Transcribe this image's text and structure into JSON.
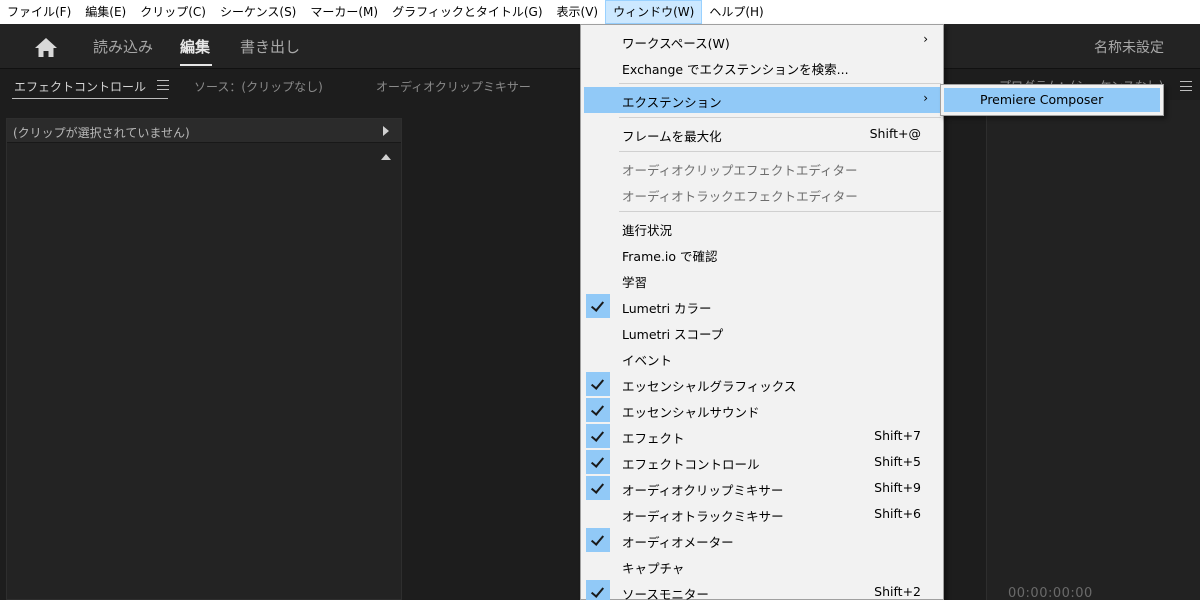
{
  "menubar": [
    "ファイル(F)",
    "編集(E)",
    "クリップ(C)",
    "シーケンス(S)",
    "マーカー(M)",
    "グラフィックとタイトル(G)",
    "表示(V)",
    "ウィンドウ(W)",
    "ヘルプ(H)"
  ],
  "workspace": {
    "tabs": [
      "読み込み",
      "編集",
      "書き出し"
    ],
    "project_title": "名称未設定"
  },
  "panel_tabs": [
    "エフェクトコントロール",
    "ソース：(クリップなし)",
    "オーディオクリップミキサー"
  ],
  "left_panel": {
    "no_clip_text": "(クリップが選択されていません)"
  },
  "right_panel": {
    "tab_label": "プログラム：(シーケンスなし)",
    "timecode": "00:00:00:00"
  },
  "window_menu": {
    "workspace": "ワークスペース(W)",
    "exchange": "Exchange でエクステンションを検索...",
    "extensions": "エクステンション",
    "maximize": "フレームを最大化",
    "maximize_shortcut": "Shift+@",
    "audio_clip_fx_editor": "オーディオクリップエフェクトエディター",
    "audio_track_fx_editor": "オーディオトラックエフェクトエディター",
    "progress": "進行状況",
    "frameio": "Frame.io で確認",
    "learn": "学習",
    "lumetri_color": "Lumetri カラー",
    "lumetri_scopes": "Lumetri スコープ",
    "events": "イベント",
    "essential_graphics": "エッセンシャルグラフィックス",
    "essential_sound": "エッセンシャルサウンド",
    "effects": "エフェクト",
    "effects_shortcut": "Shift+7",
    "effect_controls": "エフェクトコントロール",
    "effect_controls_shortcut": "Shift+5",
    "audio_clip_mixer": "オーディオクリップミキサー",
    "audio_clip_mixer_shortcut": "Shift+9",
    "audio_track_mixer": "オーディオトラックミキサー",
    "audio_track_mixer_shortcut": "Shift+6",
    "audio_meters": "オーディオメーター",
    "captions": "キャプチャ",
    "source_monitor": "ソースモニター",
    "source_monitor_shortcut": "Shift+2"
  },
  "submenu": {
    "premiere_composer": "Premiere Composer"
  },
  "colors": {
    "highlight": "#91c9f7",
    "menu_bg": "#f2f2f2",
    "app_bg": "#1d1d1d"
  }
}
